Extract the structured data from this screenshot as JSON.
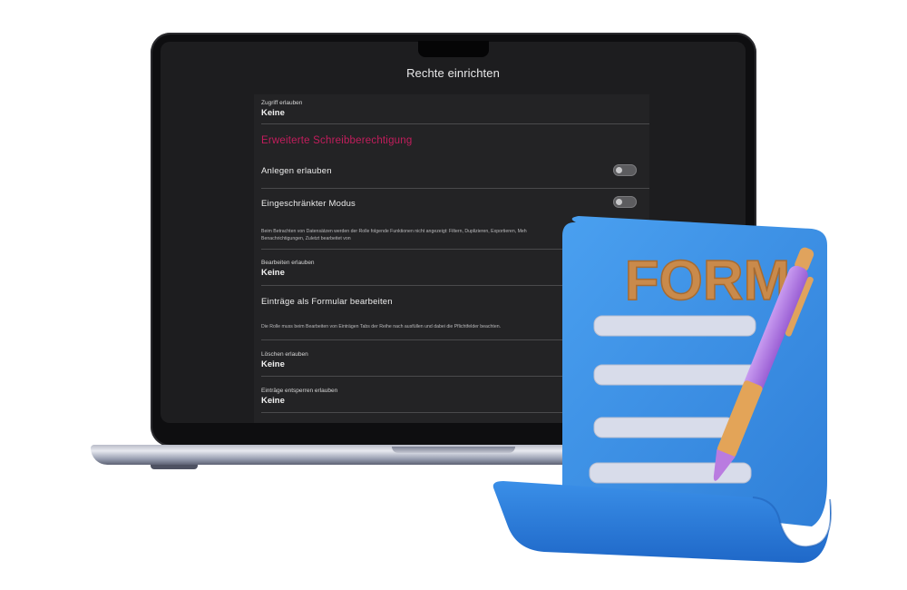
{
  "window": {
    "title": "Rechte einrichten"
  },
  "fields": {
    "zugriff": {
      "label": "Zugriff erlauben",
      "value": "Keine"
    },
    "section_title": "Erweiterte Schreibberechtigung",
    "anlegen": {
      "label": "Anlegen erlauben",
      "enabled": false
    },
    "eingeschraenkt": {
      "label": "Eingeschränkter Modus",
      "enabled": false,
      "desc_line1": "Beim Betrachten von Datensätzen werden der Rolle folgende Funktionen nicht angezeigt: Filtern, Duplizieren, Exportieren, Meh",
      "desc_line2": "Benachrichtigungen, Zuletzt bearbeitet von"
    },
    "bearbeiten": {
      "label": "Bearbeiten erlauben",
      "value": "Keine"
    },
    "formular": {
      "label": "Einträge als Formular bearbeiten",
      "desc": "Die Rolle muss beim Bearbeiten von Einträgen Tabs der Reihe nach ausfüllen und dabei die Pflichtfelder beachten."
    },
    "loeschen": {
      "label": "Löschen erlauben",
      "value": "Keine"
    },
    "entsperren": {
      "label": "Einträge entsperren erlauben",
      "value": "Keine"
    }
  },
  "illustration": {
    "form_text": "FORM"
  },
  "colors": {
    "accent": "#c21d5c",
    "screen_bg": "#1d1d1f",
    "form_blue": "#3d8fe6",
    "form_letters": "#c98a4b",
    "pen_purple": "#b97be0"
  }
}
